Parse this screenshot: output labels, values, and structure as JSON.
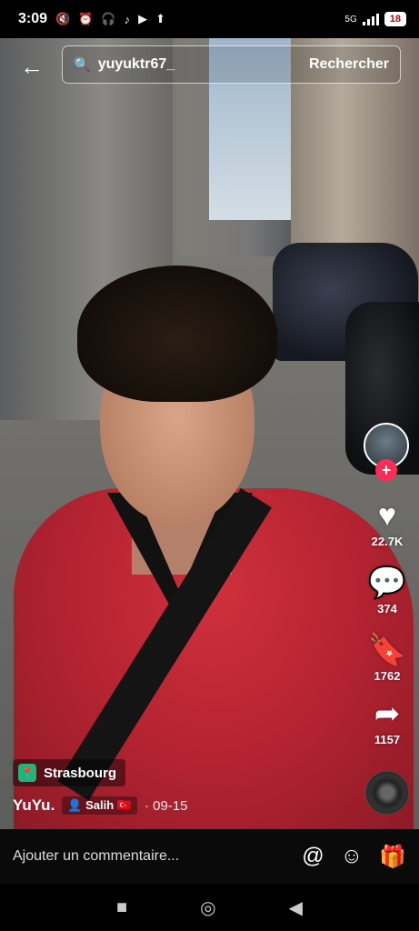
{
  "status": {
    "time": "3:09",
    "icons": [
      "mute-icon",
      "alarm-icon",
      "headphones-icon",
      "tiktok-icon",
      "play-icon",
      "upload-icon"
    ],
    "network": "5G",
    "battery": "18"
  },
  "search": {
    "query": "yuyuktr67_",
    "button_label": "Rechercher"
  },
  "rail": {
    "likes": "22.7K",
    "comments": "374",
    "saves": "1762",
    "shares": "1157"
  },
  "video": {
    "location": "Strasbourg",
    "author": "YuYu.",
    "collab": "Salih",
    "date": "· 09-15"
  },
  "comment_bar": {
    "placeholder": "Ajouter un commentaire..."
  },
  "colors": {
    "accent": "#fe2c55",
    "location_green": "#1fb47a"
  }
}
